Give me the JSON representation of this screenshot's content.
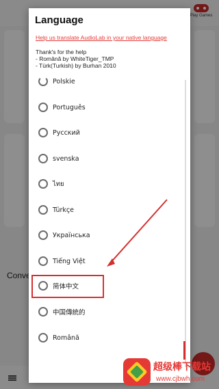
{
  "background": {
    "play_games_label": "Play Games",
    "partial_text": "Conve"
  },
  "dialog": {
    "title": "Language",
    "translate_link": "Help us translate AudioLab in your native language",
    "credits": [
      "Thank's for the help",
      "- Română by WhiteTiger_TMP",
      "- Türk(Turkish) by Burhan 2010"
    ],
    "languages": [
      {
        "label": "Polskie"
      },
      {
        "label": "Português"
      },
      {
        "label": "Русский"
      },
      {
        "label": "svenska"
      },
      {
        "label": "ไทย"
      },
      {
        "label": "Türkçe"
      },
      {
        "label": "Українська"
      },
      {
        "label": "Tiếng Việt"
      },
      {
        "label": "简体中文"
      },
      {
        "label": "中国傳統的"
      },
      {
        "label": "Română"
      }
    ]
  },
  "watermark": {
    "name": "超级棒下载站",
    "url": "www.cjbwh.com"
  },
  "colors": {
    "accent": "#e53935",
    "annotation": "#d32f2f"
  }
}
